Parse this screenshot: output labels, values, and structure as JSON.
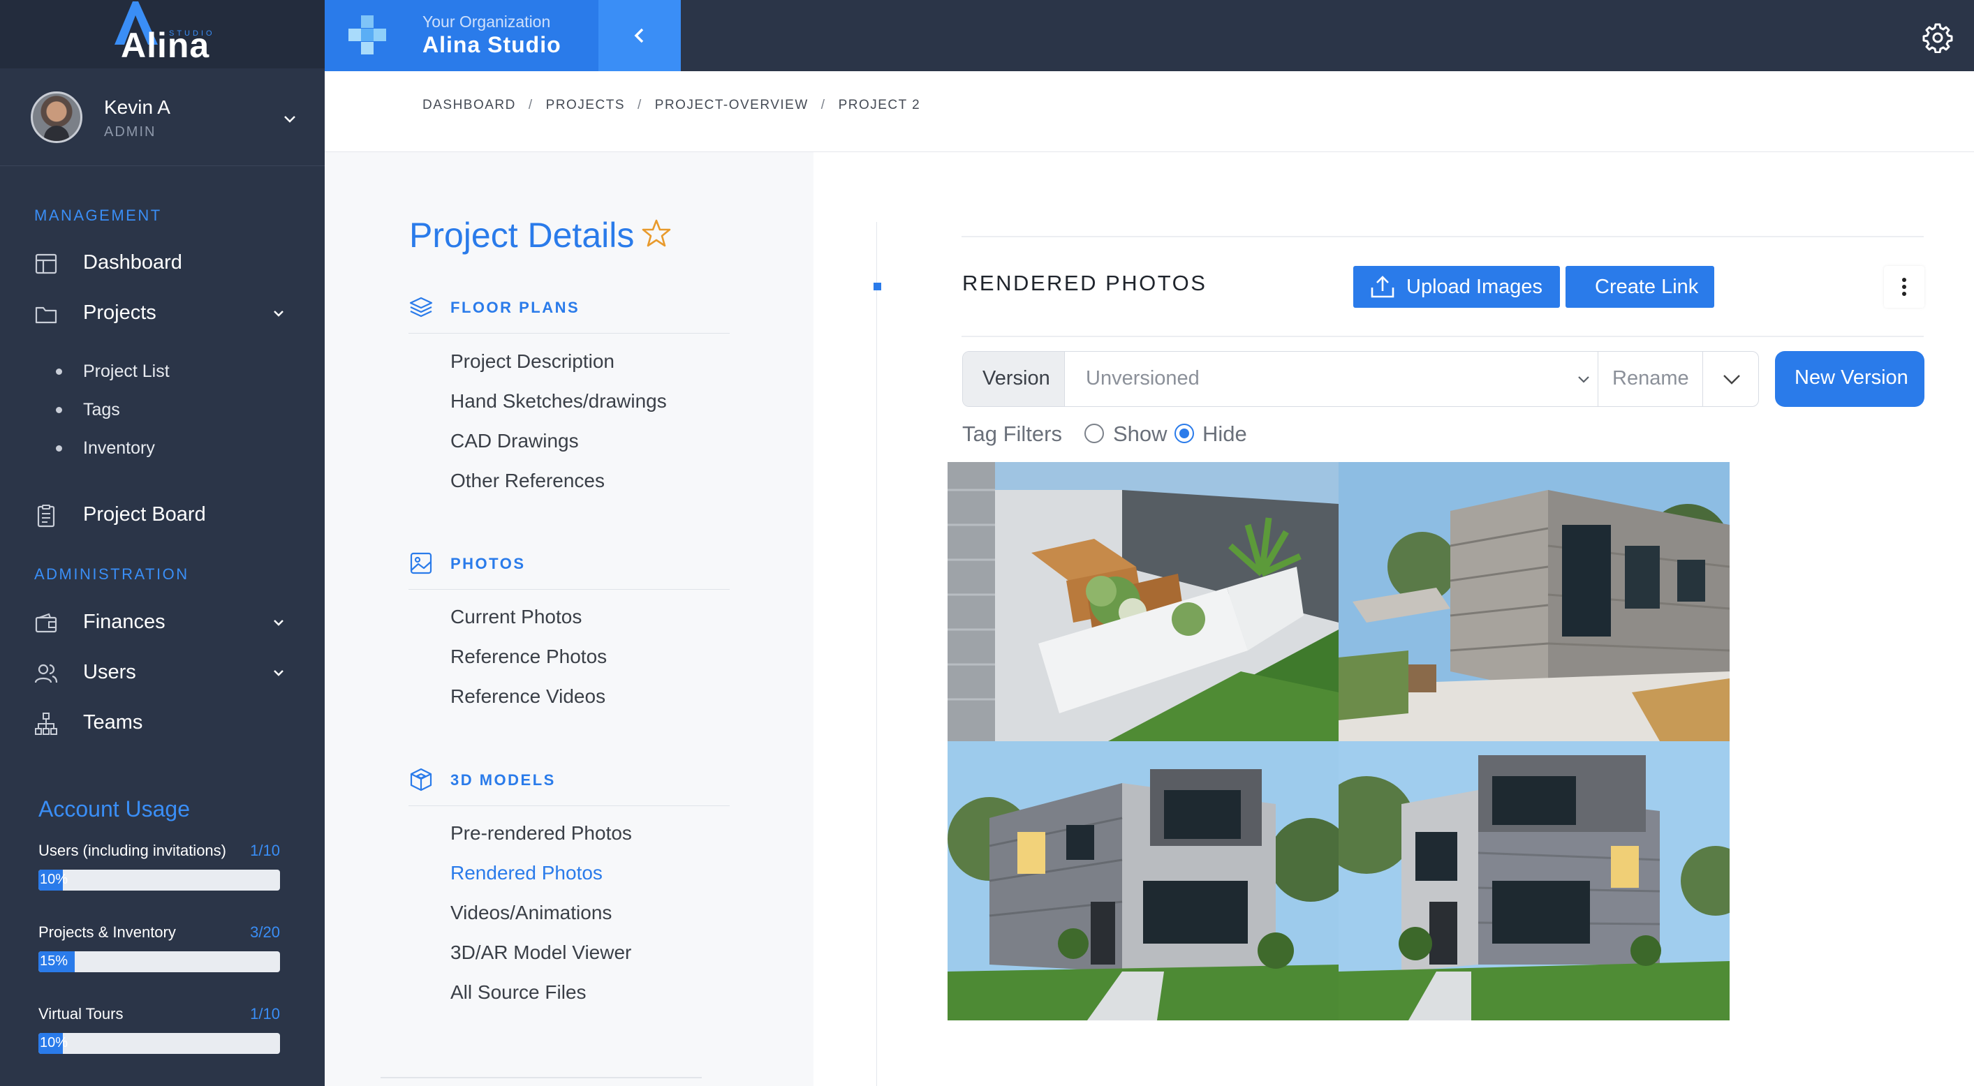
{
  "brand": {
    "logo_text": "Alina",
    "logo_sub": "STUDIO"
  },
  "user": {
    "name": "Kevin A",
    "role": "ADMIN"
  },
  "sidebar": {
    "management_label": "MANAGEMENT",
    "administration_label": "ADMINISTRATION",
    "items": [
      {
        "label": "Dashboard",
        "icon": "layout-icon"
      },
      {
        "label": "Projects",
        "icon": "folder-icon",
        "expanded": true
      },
      {
        "label": "Project Board",
        "icon": "clipboard-icon"
      },
      {
        "label": "Finances",
        "icon": "wallet-icon"
      },
      {
        "label": "Users",
        "icon": "users-icon"
      },
      {
        "label": "Teams",
        "icon": "org-chart-icon"
      }
    ],
    "project_sub": [
      "Project List",
      "Tags",
      "Inventory"
    ]
  },
  "usage": {
    "title": "Account Usage",
    "items": [
      {
        "label": "Users (including invitations)",
        "count": "1/10",
        "percent_label": "10%",
        "fraction": 0.1
      },
      {
        "label": "Projects & Inventory",
        "count": "3/20",
        "percent_label": "15%",
        "fraction": 0.15
      },
      {
        "label": "Virtual Tours",
        "count": "1/10",
        "percent_label": "10%",
        "fraction": 0.1
      }
    ]
  },
  "header": {
    "org_sub": "Your Organization",
    "org_name": "Alina Studio"
  },
  "breadcrumb": [
    "DASHBOARD",
    "PROJECTS",
    "PROJECT-OVERVIEW",
    "PROJECT 2"
  ],
  "details": {
    "title": "Project Details",
    "groups": [
      {
        "label": "FLOOR PLANS",
        "icon": "layers-icon",
        "links": [
          "Project Description",
          "Hand Sketches/drawings",
          "CAD Drawings",
          "Other References"
        ]
      },
      {
        "label": "PHOTOS",
        "icon": "image-icon",
        "links": [
          "Current Photos",
          "Reference Photos",
          "Reference Videos"
        ]
      },
      {
        "label": "3D MODELS",
        "icon": "cube-icon",
        "links": [
          "Pre-rendered Photos",
          "Rendered Photos",
          "Videos/Animations",
          "3D/AR Model Viewer",
          "All Source Files"
        ]
      }
    ],
    "active_link": "Rendered Photos"
  },
  "main": {
    "section_title": "RENDERED PHOTOS",
    "upload_label": "Upload Images",
    "create_link_label": "Create Link",
    "version_label": "Version",
    "version_value": "Unversioned",
    "rename_label": "Rename",
    "new_version_label": "New Version",
    "tag_filters_label": "Tag Filters",
    "show_label": "Show",
    "hide_label": "Hide",
    "tag_filter_selected": "Hide"
  },
  "colors": {
    "sidebar": "#2b3548",
    "accent": "#2a7bea",
    "accent_light": "#3a8ef6"
  }
}
